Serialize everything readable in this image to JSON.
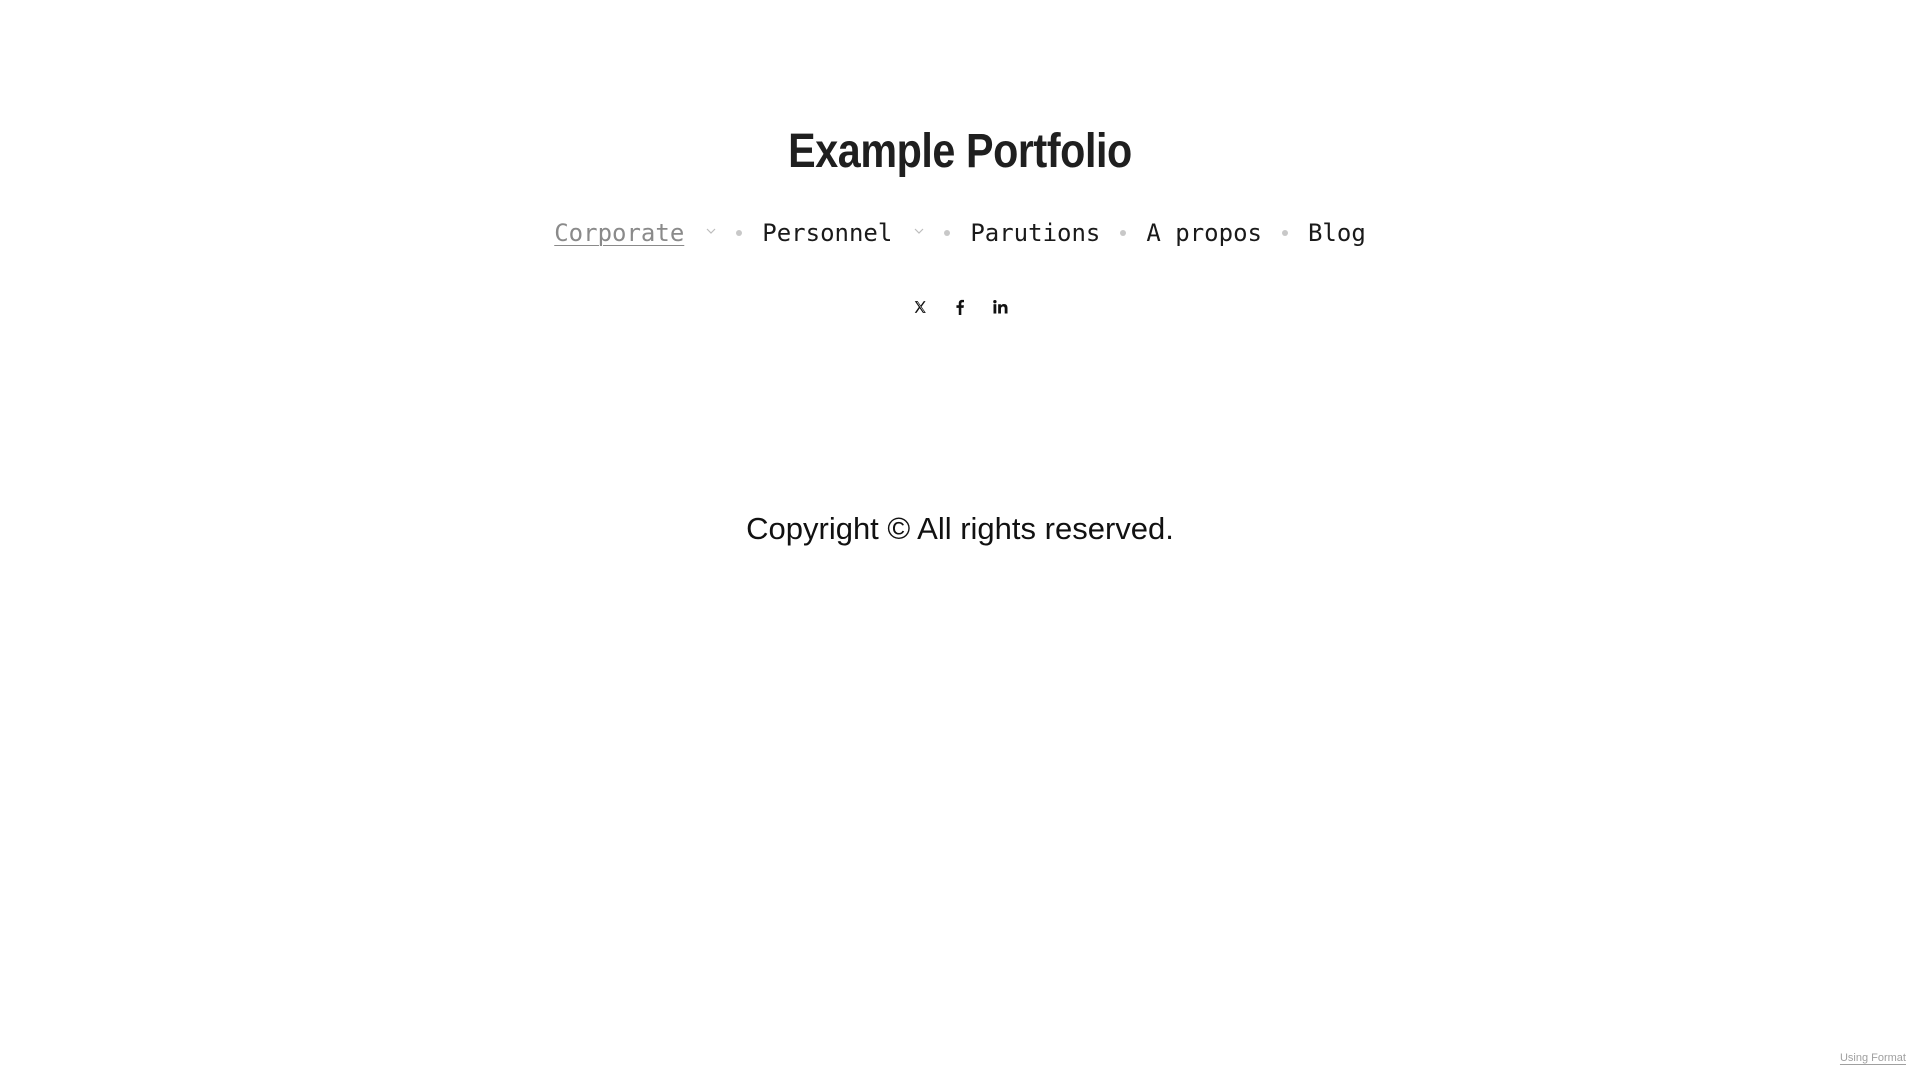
{
  "site": {
    "title": "Example Portfolio"
  },
  "nav": {
    "items": [
      {
        "label": "Corporate",
        "active": true,
        "has_dropdown": true
      },
      {
        "label": "Personnel",
        "active": false,
        "has_dropdown": true
      },
      {
        "label": "Parutions",
        "active": false,
        "has_dropdown": false
      },
      {
        "label": "A propos",
        "active": false,
        "has_dropdown": false
      },
      {
        "label": "Blog",
        "active": false,
        "has_dropdown": false
      }
    ],
    "dropdown_icon": "chevron-down-icon",
    "separator_color": "#c8c8c8",
    "active_color": "#8a8a8a"
  },
  "social": {
    "links": [
      {
        "icon": "x-twitter-icon"
      },
      {
        "icon": "facebook-icon"
      },
      {
        "icon": "linkedin-icon"
      }
    ]
  },
  "footer": {
    "copyright": "Copyright © All rights reserved.",
    "badge": "Using Format"
  }
}
